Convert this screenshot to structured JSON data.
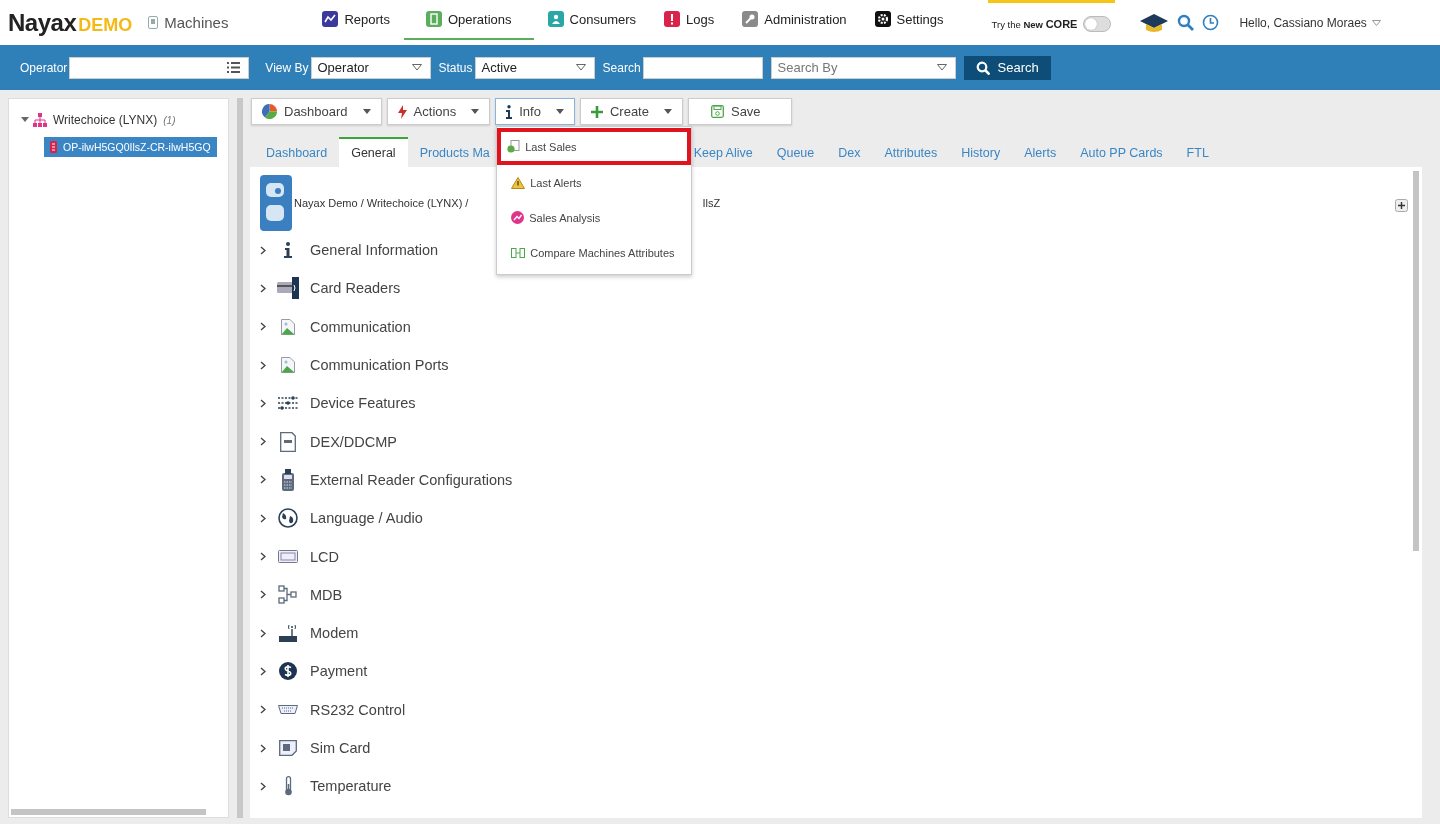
{
  "header": {
    "logo_main": "Nayax",
    "logo_sub": "DEMO",
    "page_title": "Machines",
    "nav": [
      {
        "label": "Reports",
        "kind": "chart",
        "selected": false
      },
      {
        "label": "Operations",
        "kind": "door",
        "selected": true
      },
      {
        "label": "Consumers",
        "kind": "people",
        "selected": false
      },
      {
        "label": "Logs",
        "kind": "alert",
        "selected": false
      },
      {
        "label": "Administration",
        "kind": "key",
        "selected": false
      },
      {
        "label": "Settings",
        "kind": "gear",
        "selected": false
      }
    ],
    "core_toggle": {
      "prefix": "Try the",
      "bold": "New",
      "brand": "CORE",
      "on": false
    },
    "greeting": "Hello, Cassiano Moraes"
  },
  "filter_bar": {
    "operator_label": "Operator",
    "view_by_label": "View By",
    "view_by_value": "Operator",
    "status_label": "Status",
    "status_value": "Active",
    "search_label": "Search",
    "search_by_placeholder": "Search By",
    "search_button": "Search"
  },
  "tree": {
    "items": [
      {
        "label": "Writechoice (LYNX)",
        "count": "(1)",
        "expanded": true,
        "selected": false,
        "children": [
          {
            "label": "OP-ilwH5GQ0IlsZ-CR-ilwH5GQ",
            "selected": true
          }
        ]
      }
    ]
  },
  "toolbar": [
    {
      "label": "Dashboard",
      "kind": "pie",
      "open": false
    },
    {
      "label": "Actions",
      "kind": "bolt",
      "open": false
    },
    {
      "label": "Info",
      "kind": "info",
      "open": true
    },
    {
      "label": "Create",
      "kind": "plus",
      "open": false
    },
    {
      "label": "Save",
      "kind": "save",
      "open": false
    }
  ],
  "info_menu": [
    {
      "label": "Last Sales",
      "kind": "sales",
      "selected": true
    },
    {
      "label": "Last Alerts",
      "kind": "warning",
      "selected": false
    },
    {
      "label": "Sales Analysis",
      "kind": "analysis",
      "selected": false
    },
    {
      "label": "Compare Machines Attributes",
      "kind": "compare",
      "selected": false
    }
  ],
  "tabs": [
    {
      "label": "Dashboard",
      "selected": false
    },
    {
      "label": "General",
      "selected": true
    },
    {
      "label": "Products Ma",
      "selected": false
    },
    {
      "label": "Keep Alive",
      "selected": false
    },
    {
      "label": "Queue",
      "selected": false
    },
    {
      "label": "Dex",
      "selected": false
    },
    {
      "label": "Attributes",
      "selected": false
    },
    {
      "label": "History",
      "selected": false
    },
    {
      "label": "Alerts",
      "selected": false
    },
    {
      "label": "Auto PP Cards",
      "selected": false
    },
    {
      "label": "FTL",
      "selected": false
    }
  ],
  "breadcrumb": {
    "start": "Nayax Demo / Writechoice (LYNX) /",
    "end": "IlsZ"
  },
  "sections": [
    {
      "label": "General Information",
      "kind": "info"
    },
    {
      "label": "Card Readers",
      "kind": "card"
    },
    {
      "label": "Communication",
      "kind": "broken"
    },
    {
      "label": "Communication Ports",
      "kind": "broken"
    },
    {
      "label": "Device Features",
      "kind": "sliders"
    },
    {
      "label": "DEX/DDCMP",
      "kind": "doc"
    },
    {
      "label": "External Reader Configurations",
      "kind": "reader"
    },
    {
      "label": "Language / Audio",
      "kind": "globe"
    },
    {
      "label": "LCD",
      "kind": "lcd"
    },
    {
      "label": "MDB",
      "kind": "mdb"
    },
    {
      "label": "Modem",
      "kind": "modem"
    },
    {
      "label": "Payment",
      "kind": "dollar"
    },
    {
      "label": "RS232 Control",
      "kind": "serial"
    },
    {
      "label": "Sim Card",
      "kind": "sim"
    },
    {
      "label": "Temperature",
      "kind": "thermo"
    }
  ]
}
